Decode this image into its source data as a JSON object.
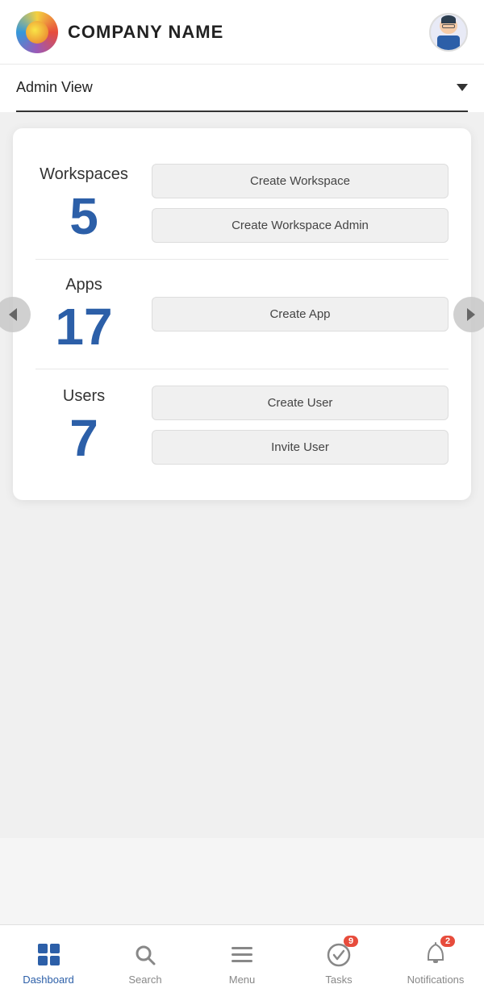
{
  "header": {
    "company_name": "COMPANY NAME",
    "logo_alt": "Company Logo"
  },
  "view_selector": {
    "label": "Admin View",
    "chevron_label": "dropdown chevron"
  },
  "dashboard": {
    "workspaces": {
      "title": "Workspaces",
      "count": "5",
      "btn_create": "Create Workspace",
      "btn_create_admin": "Create Workspace Admin"
    },
    "apps": {
      "title": "Apps",
      "count": "17",
      "btn_create": "Create App"
    },
    "users": {
      "title": "Users",
      "count": "7",
      "btn_create": "Create User",
      "btn_invite": "Invite User"
    }
  },
  "bottom_nav": {
    "dashboard": "Dashboard",
    "search": "Search",
    "menu": "Menu",
    "tasks": "Tasks",
    "tasks_badge": "9",
    "notifications": "Notifications",
    "notifications_badge": "2"
  }
}
